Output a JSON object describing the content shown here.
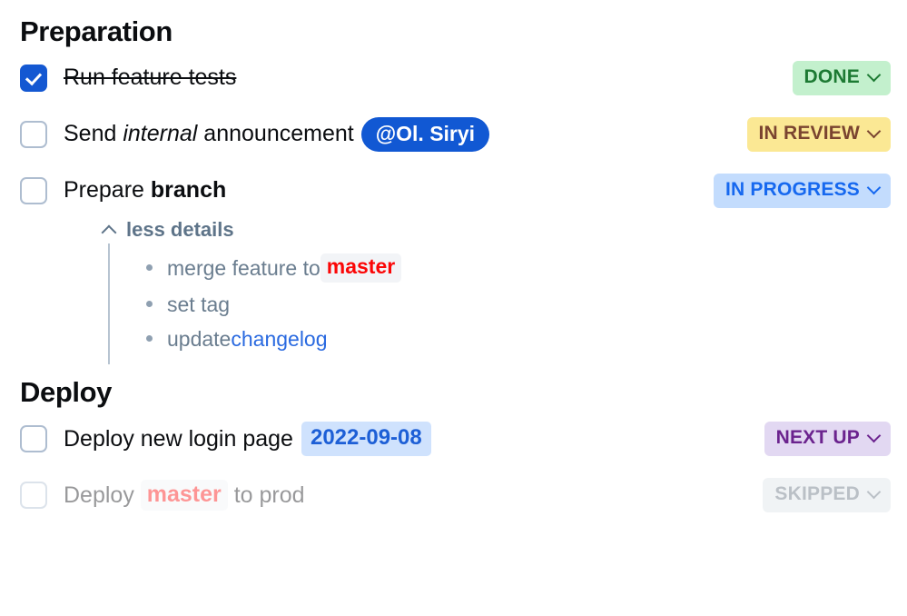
{
  "sections": [
    {
      "title": "Preparation",
      "tasks": [
        {
          "checked": true,
          "struck": true,
          "text": "Run feature tests",
          "status": {
            "label": "DONE",
            "variant": "done"
          }
        },
        {
          "checked": false,
          "struck": false,
          "text_a": "Send ",
          "text_em": "internal",
          "text_b": " announcement",
          "mention": "@Ol. Siryi",
          "status": {
            "label": "IN REVIEW",
            "variant": "review"
          }
        },
        {
          "checked": false,
          "struck": false,
          "text_a": "Prepare ",
          "text_strong": "branch",
          "status": {
            "label": "IN PROGRESS",
            "variant": "progress"
          },
          "details": {
            "toggle_label": "less details",
            "toggle_icon": "chevron-up-icon",
            "bullets": [
              {
                "text_a": "merge feature to ",
                "code": "master"
              },
              {
                "text_a": "set tag"
              },
              {
                "text_a": "update ",
                "link": "changelog"
              }
            ]
          }
        }
      ]
    },
    {
      "title": "Deploy",
      "tasks": [
        {
          "checked": false,
          "struck": false,
          "text_a": "Deploy new login page",
          "date": "2022-09-08",
          "status": {
            "label": "NEXT UP",
            "variant": "next"
          }
        },
        {
          "checked": false,
          "struck": false,
          "dim": true,
          "text_a": "Deploy ",
          "code": "master",
          "text_b": " to prod",
          "status": {
            "label": "SKIPPED",
            "variant": "skipped"
          }
        }
      ]
    }
  ],
  "colors": {
    "checkbox_checked": "#1458d2",
    "checkbox_border": "#aebdd0",
    "mention_bg": "#1158d3",
    "date_bg": "#cfe2fd",
    "date_text": "#1d5fd6",
    "code_text": "#fb0606",
    "code_bg": "#f2f4f7",
    "link": "#2a6ae0",
    "muted_text": "#6a7d8f",
    "badge_done_bg": "#c3f0cd",
    "badge_done_text": "#1d7a33",
    "badge_review_bg": "#fbe894",
    "badge_review_text": "#7a4430",
    "badge_progress_bg": "#c3dcfd",
    "badge_progress_text": "#1668ef",
    "badge_next_bg": "#e2d8f2",
    "badge_next_text": "#6b238e",
    "badge_skipped_bg": "#dde3e9",
    "badge_skipped_text": "#5d6b7a"
  }
}
